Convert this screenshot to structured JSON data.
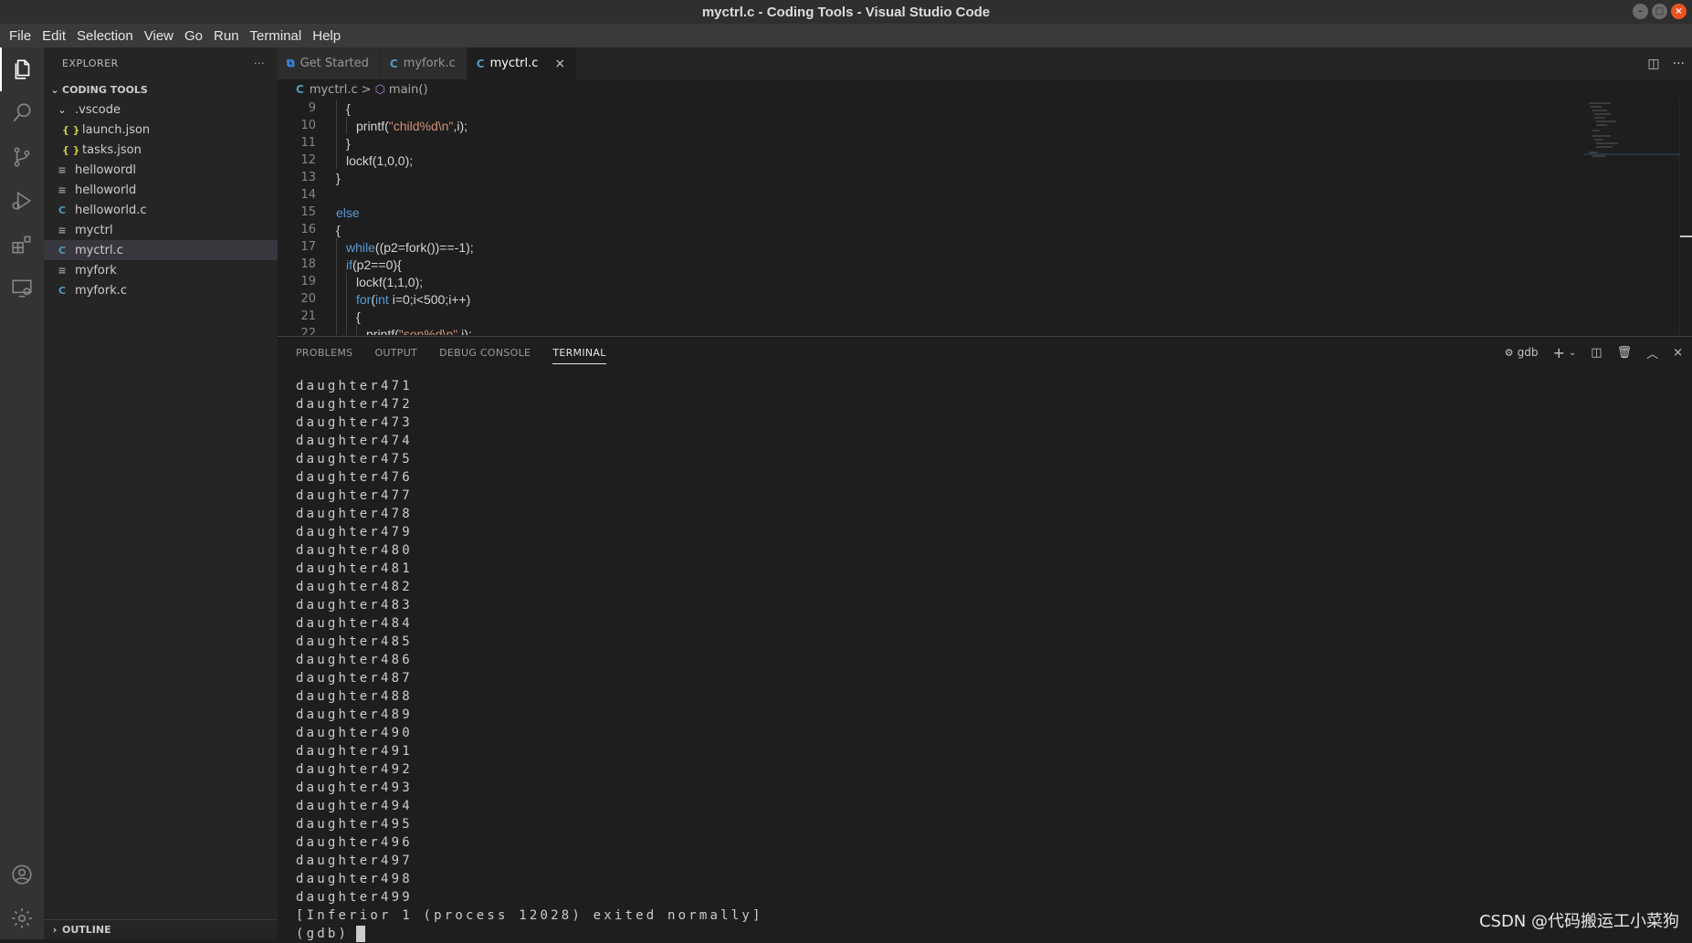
{
  "window": {
    "title": "myctrl.c - Coding Tools - Visual Studio Code",
    "controls": [
      "minimize",
      "maximize",
      "close"
    ]
  },
  "menu": [
    "File",
    "Edit",
    "Selection",
    "View",
    "Go",
    "Run",
    "Terminal",
    "Help"
  ],
  "activity_bar": [
    "explorer-icon",
    "search-icon",
    "source-control-icon",
    "run-debug-icon",
    "extensions-icon",
    "remote-explorer-icon",
    "accounts-icon",
    "settings-gear-icon"
  ],
  "sidebar": {
    "header": "EXPLORER",
    "more": "···",
    "section": "CODING TOOLS",
    "tree": [
      {
        "label": ".vscode",
        "type": "folder",
        "icon": "chevron-down-icon"
      },
      {
        "label": "launch.json",
        "type": "json",
        "icon": "{ }"
      },
      {
        "label": "tasks.json",
        "type": "json",
        "icon": "{ }"
      },
      {
        "label": "hellowordl",
        "type": "text",
        "icon": "≡"
      },
      {
        "label": "helloworld",
        "type": "text",
        "icon": "≡"
      },
      {
        "label": "helloworld.c",
        "type": "c",
        "icon": "C"
      },
      {
        "label": "myctrl",
        "type": "text",
        "icon": "≡"
      },
      {
        "label": "myctrl.c",
        "type": "c",
        "icon": "C",
        "selected": true
      },
      {
        "label": "myfork",
        "type": "text",
        "icon": "≡"
      },
      {
        "label": "myfork.c",
        "type": "c",
        "icon": "C"
      }
    ],
    "outline": "OUTLINE"
  },
  "tabs": [
    {
      "label": "Get Started",
      "icon": "vscode-logo-icon",
      "active": false
    },
    {
      "label": "myfork.c",
      "icon": "C",
      "active": false
    },
    {
      "label": "myctrl.c",
      "icon": "C",
      "active": true,
      "close": "×"
    }
  ],
  "breadcrumb": {
    "file": "myctrl.c",
    "file_icon": "C",
    "sep": ">",
    "symbol": "main()"
  },
  "code": [
    {
      "ln": "9",
      "indent": 1,
      "text": "{"
    },
    {
      "ln": "10",
      "indent": 2,
      "text": "printf(\"child%d\\n\",i);"
    },
    {
      "ln": "11",
      "indent": 1,
      "text": "}"
    },
    {
      "ln": "12",
      "indent": 1,
      "text": "lockf(1,0,0);"
    },
    {
      "ln": "13",
      "indent": 0,
      "text": "}"
    },
    {
      "ln": "14",
      "indent": 0,
      "text": ""
    },
    {
      "ln": "15",
      "indent": 0,
      "text": "else"
    },
    {
      "ln": "16",
      "indent": 0,
      "text": "{"
    },
    {
      "ln": "17",
      "indent": 1,
      "text": "while((p2=fork())==-1);"
    },
    {
      "ln": "18",
      "indent": 1,
      "text": "if(p2==0){"
    },
    {
      "ln": "19",
      "indent": 2,
      "text": "lockf(1,1,0);"
    },
    {
      "ln": "20",
      "indent": 2,
      "text": "for(int i=0;i<500;i++)"
    },
    {
      "ln": "21",
      "indent": 2,
      "text": "{"
    },
    {
      "ln": "22",
      "indent": 3,
      "text": "printf(\"son%d\\n\",i);"
    }
  ],
  "panel": {
    "tabs": [
      "PROBLEMS",
      "OUTPUT",
      "DEBUG CONSOLE",
      "TERMINAL"
    ],
    "active_tab": "TERMINAL",
    "terminal_name": "gdb",
    "actions": [
      "plus-icon",
      "chevron-down-icon",
      "split-icon",
      "trash-icon",
      "chevron-up-icon",
      "close-icon"
    ]
  },
  "terminal_lines": [
    "daughter471",
    "daughter472",
    "daughter473",
    "daughter474",
    "daughter475",
    "daughter476",
    "daughter477",
    "daughter478",
    "daughter479",
    "daughter480",
    "daughter481",
    "daughter482",
    "daughter483",
    "daughter484",
    "daughter485",
    "daughter486",
    "daughter487",
    "daughter488",
    "daughter489",
    "daughter490",
    "daughter491",
    "daughter492",
    "daughter493",
    "daughter494",
    "daughter495",
    "daughter496",
    "daughter497",
    "daughter498",
    "daughter499",
    "[Inferior 1 (process 12028) exited normally]",
    "(gdb)"
  ],
  "watermark": "CSDN @代码搬运工小菜狗",
  "colors": {
    "accent": "#007acc",
    "close_button": "#e95420",
    "keyword": "#569cd6",
    "string": "#ce9178"
  }
}
